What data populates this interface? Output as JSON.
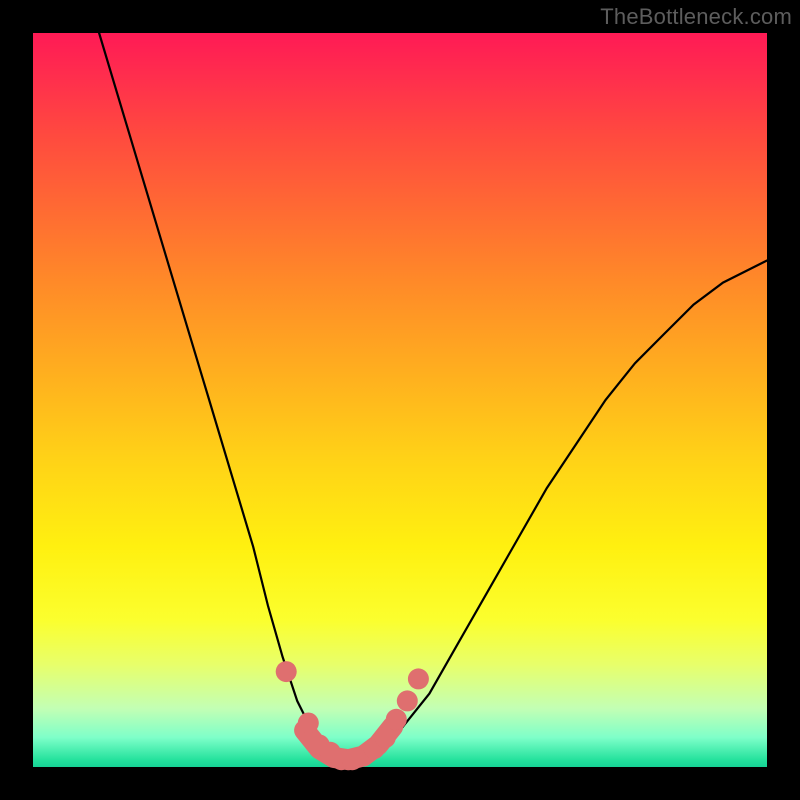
{
  "watermark": "TheBottleneck.com",
  "colors": {
    "frame": "#000000",
    "curve": "#000000",
    "marker": "#df6f6f",
    "gradient_top": "#ff1a55",
    "gradient_bottom": "#16d396"
  },
  "chart_data": {
    "type": "line",
    "title": "",
    "xlabel": "",
    "ylabel": "",
    "xlim": [
      0,
      100
    ],
    "ylim": [
      0,
      100
    ],
    "series": [
      {
        "name": "bottleneck-curve",
        "x": [
          9,
          12,
          15,
          18,
          21,
          24,
          27,
          30,
          32,
          34,
          36,
          38,
          40,
          42,
          44,
          47,
          50,
          54,
          58,
          62,
          66,
          70,
          74,
          78,
          82,
          86,
          90,
          94,
          98,
          100
        ],
        "y": [
          100,
          90,
          80,
          70,
          60,
          50,
          40,
          30,
          22,
          15,
          9,
          5,
          2,
          1,
          1,
          2,
          5,
          10,
          17,
          24,
          31,
          38,
          44,
          50,
          55,
          59,
          63,
          66,
          68,
          69
        ]
      }
    ],
    "markers": {
      "name": "highlighted-points",
      "x": [
        34.5,
        37.5,
        39,
        40.5,
        42,
        43.5,
        45,
        46.5,
        48,
        49.5,
        51,
        52.5
      ],
      "y": [
        13,
        6,
        3,
        2,
        1,
        1,
        1.5,
        2.5,
        4,
        6.5,
        9,
        12
      ]
    },
    "trough_band": {
      "x": [
        37,
        39,
        41,
        43,
        45,
        47,
        49
      ],
      "y": [
        5,
        2.5,
        1.3,
        1,
        1.5,
        3,
        5.5
      ]
    },
    "annotations": []
  }
}
